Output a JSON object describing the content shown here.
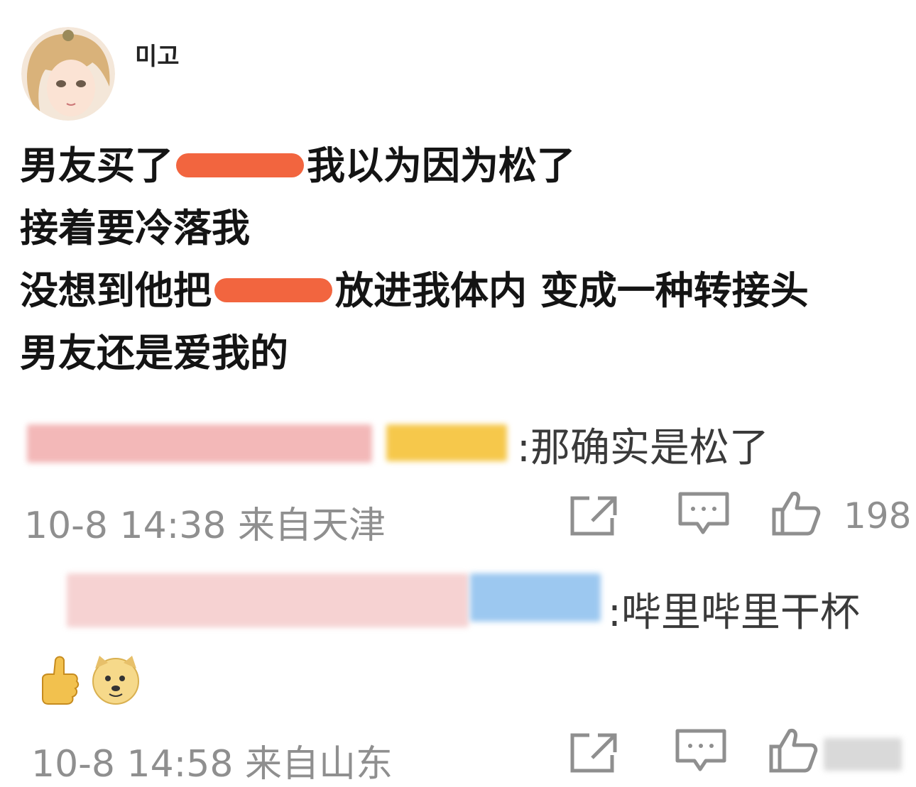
{
  "post": {
    "author": "미고",
    "lines": [
      [
        "男友买了",
        "我以为因为松了"
      ],
      [
        "接着要冷落我"
      ],
      [
        "没想到他把",
        "放进我体内 变成一种转接头"
      ],
      [
        "男友还是爱我的"
      ]
    ]
  },
  "comments": [
    {
      "text": ":那确实是松了",
      "time": "10-8 14:38",
      "location": "来自天津",
      "likes": "198",
      "actions": [
        "share-icon",
        "comment-icon",
        "like-icon"
      ]
    },
    {
      "text": ":哔里哔里干杯",
      "time": "10-8 14:58",
      "location": "来自山东",
      "emojis": [
        "thumbs-up-emoji",
        "doge-emoji"
      ],
      "actions": [
        "share-icon",
        "comment-icon",
        "like-icon"
      ]
    }
  ],
  "colors": {
    "redaction": "#f2653f",
    "meta_text": "#8f8f8f",
    "username_blur": "#f3b8b8",
    "badge_yellow": "#f6c84b",
    "badge_blue": "#9cc8f0"
  }
}
